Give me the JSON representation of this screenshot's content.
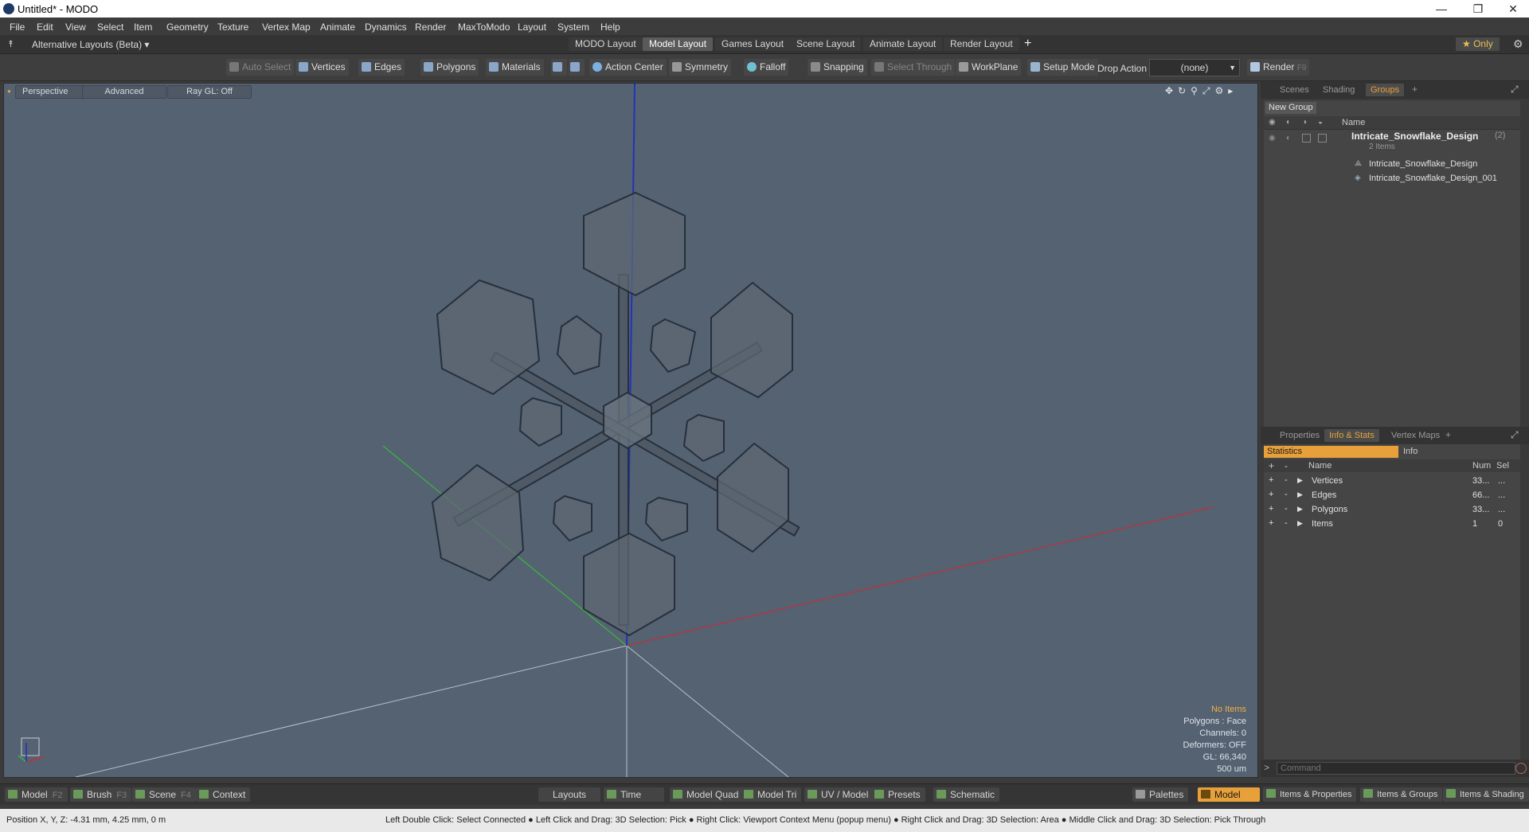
{
  "window": {
    "title": "Untitled* - MODO",
    "minimize": "—",
    "restore": "❐",
    "close": "✕"
  },
  "menu": [
    "File",
    "Edit",
    "View",
    "Select",
    "Item",
    "Geometry",
    "Texture",
    "Vertex Map",
    "Animate",
    "Dynamics",
    "Render",
    "MaxToModo",
    "Layout",
    "System",
    "Help"
  ],
  "layoutbar": {
    "alt_layouts": "Alternative Layouts (Beta) ▾",
    "tabs": [
      "MODO Layout",
      "Model Layout",
      "Games Layout",
      "Scene Layout",
      "Animate Layout",
      "Render Layout"
    ],
    "active_tab": "Model Layout",
    "add": "+",
    "only": "★ Only"
  },
  "toolbar": {
    "auto_select": "Auto Select",
    "vertices": "Vertices",
    "edges": "Edges",
    "polygons": "Polygons",
    "materials": "Materials",
    "action_center": "Action Center",
    "symmetry": "Symmetry",
    "falloff": "Falloff",
    "snapping": "Snapping",
    "select_through": "Select Through",
    "workplane": "WorkPlane",
    "setup_mode": "Setup Mode",
    "drop_action_label": "Drop Action",
    "drop_action_value": "(none)",
    "render": "Render",
    "render_key": "F9"
  },
  "viewport": {
    "perspective": "Perspective",
    "advanced": "Advanced",
    "raygl": "Ray GL: Off",
    "info": {
      "no_items": "No Items",
      "polygons": "Polygons : Face",
      "channels": "Channels: 0",
      "deformers": "Deformers: OFF",
      "gl": "GL: 66,340",
      "scale": "500 um"
    }
  },
  "scene_panel": {
    "tabs": [
      "Scenes",
      "Shading",
      "Groups"
    ],
    "active_tab": "Groups",
    "new_group": "New Group",
    "col_name": "Name",
    "group_name": "Intricate_Snowflake_Design",
    "group_count": "(2)",
    "group_items": "2 Items",
    "children": [
      "Intricate_Snowflake_Design",
      "Intricate_Snowflake_Design_001"
    ]
  },
  "props_panel": {
    "tabs": [
      "Properties",
      "Info & Stats",
      "Vertex Maps"
    ],
    "active_tab": "Info & Stats",
    "statistics": "Statistics",
    "info": "Info",
    "col_name": "Name",
    "col_num": "Num",
    "col_sel": "Sel",
    "rows": [
      {
        "name": "Vertices",
        "num": "33...",
        "sel": "..."
      },
      {
        "name": "Edges",
        "num": "66...",
        "sel": "..."
      },
      {
        "name": "Polygons",
        "num": "33...",
        "sel": "..."
      },
      {
        "name": "Items",
        "num": "1",
        "sel": "0"
      }
    ],
    "command_placeholder": "Command"
  },
  "bottombar": {
    "left": [
      {
        "label": "Model",
        "key": "F2"
      },
      {
        "label": "Brush",
        "key": "F3"
      },
      {
        "label": "Scene",
        "key": "F4"
      },
      {
        "label": "Context",
        "key": ""
      }
    ],
    "center": [
      "Layouts",
      "Time",
      "Model Quad",
      "Model Tri",
      "UV / Model",
      "Presets",
      "Schematic"
    ],
    "palettes": "Palettes",
    "model": "Model",
    "right": [
      "Items & Properties",
      "Items & Groups",
      "Items & Shading"
    ]
  },
  "statusbar": {
    "position": "Position X, Y, Z:   -4.31 mm, 4.25 mm, 0 m",
    "hints": "Left Double Click: Select Connected ● Left Click and Drag: 3D Selection: Pick ● Right Click: Viewport Context Menu (popup menu) ● Right Click and Drag: 3D Selection: Area ● Middle Click and Drag: 3D Selection: Pick Through"
  }
}
